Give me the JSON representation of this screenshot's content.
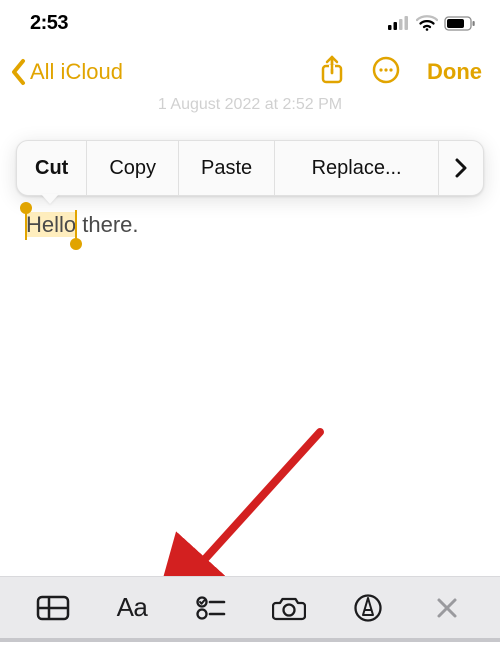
{
  "status": {
    "time": "2:53"
  },
  "nav": {
    "back_label": "All iCloud",
    "done_label": "Done",
    "faded_date": "1 August 2022 at 2:52 PM"
  },
  "context_menu": {
    "cut": "Cut",
    "copy": "Copy",
    "paste": "Paste",
    "replace": "Replace..."
  },
  "note": {
    "selected_text": "Hello",
    "rest_text": " there."
  },
  "toolbar": {
    "aa_label": "Aa"
  },
  "colors": {
    "accent": "#E1A400",
    "arrow": "#D32020"
  }
}
